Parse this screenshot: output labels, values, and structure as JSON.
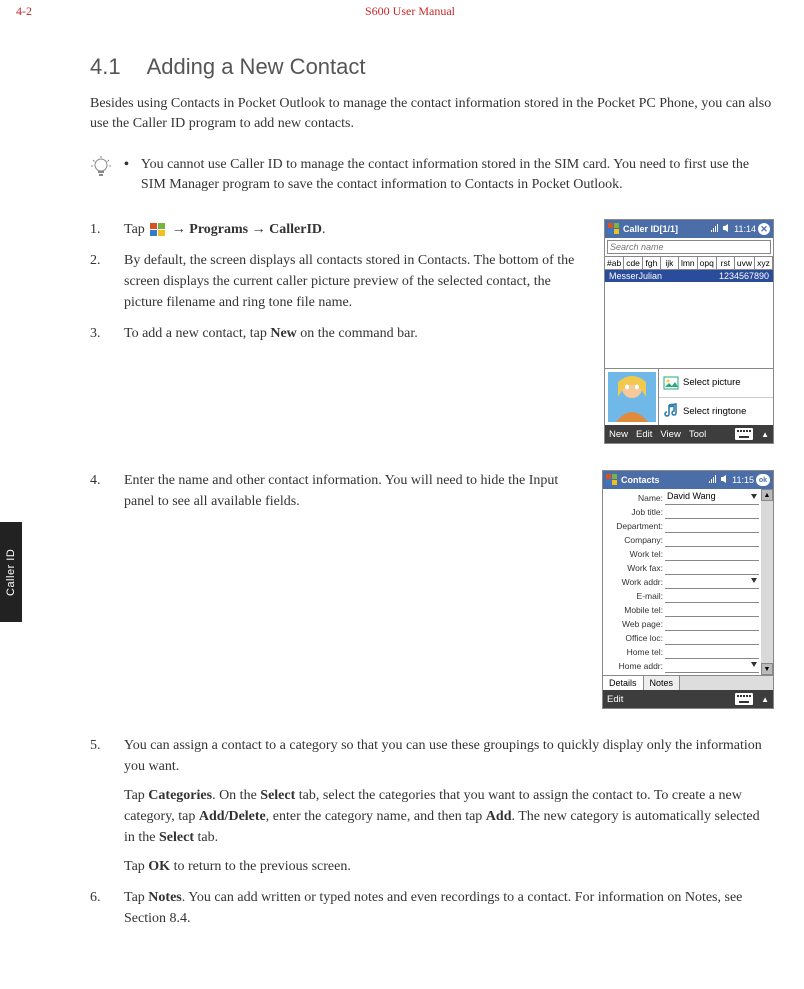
{
  "header": {
    "page": "4-2",
    "manual": "S600 User Manual"
  },
  "side_tab": "Caller ID",
  "section": {
    "number": "4.1",
    "title": "Adding a New Contact"
  },
  "intro": "Besides using Contacts in Pocket Outlook to manage the contact information stored in the Pocket PC Phone, you can also use the Caller ID program to add new contacts.",
  "note": {
    "bullet": "•",
    "text": "You cannot use Caller ID to manage the contact information stored in the SIM card. You need to first use the SIM Manager program to save the contact information to Contacts in Pocket Outlook."
  },
  "steps": {
    "s1_a": "Tap ",
    "s1_b": " → ",
    "s1_programs": "Programs",
    "s1_c": " → ",
    "s1_callerid": "CallerID",
    "s1_d": ".",
    "s2": "By default, the screen displays all contacts stored in Contacts. The bottom of the screen displays the current caller picture preview of the selected contact, the picture filename and ring tone file name.",
    "s3_a": "To add a new contact, tap ",
    "s3_b": "New",
    "s3_c": " on the command bar.",
    "s4": "Enter the name and other contact information. You will need to hide the Input panel to see all available fields.",
    "s5_p1": "You can assign a contact to a category so that you can use these groupings to quickly display only the information you want.",
    "s5_p2_a": "Tap ",
    "s5_p2_b": "Categories",
    "s5_p2_c": ". On the ",
    "s5_p2_d": "Select",
    "s5_p2_e": " tab, select the categories that you want to assign the contact to. To create a new category, tap ",
    "s5_p2_f": "Add/Delete",
    "s5_p2_g": ", enter the category name, and then tap ",
    "s5_p2_h": "Add",
    "s5_p2_i": ". The new category is automatically selected in the ",
    "s5_p2_j": "Select",
    "s5_p2_k": " tab.",
    "s5_p3_a": "Tap ",
    "s5_p3_b": "OK",
    "s5_p3_c": " to return to the previous screen.",
    "s6_a": "Tap ",
    "s6_b": "Notes",
    "s6_c": ". You can add written or typed notes and even recordings to a contact. For information on Notes, see Section 8.4."
  },
  "shot1": {
    "title": "Caller ID[1/1]",
    "time": "11:14",
    "search_ph": "Search name",
    "tabs": [
      "#ab",
      "cde",
      "fgh",
      "ijk",
      "lmn",
      "opq",
      "rst",
      "uvw",
      "xyz"
    ],
    "contact_name": "MesserJulian",
    "contact_num": "1234567890",
    "btn_pic": "Select picture",
    "btn_ring": "Select ringtone",
    "cmd": [
      "New",
      "Edit",
      "View",
      "Tool"
    ]
  },
  "shot2": {
    "title": "Contacts",
    "time": "11:15",
    "ok": "ok",
    "labels": [
      "Name:",
      "Job title:",
      "Department:",
      "Company:",
      "Work tel:",
      "Work fax:",
      "Work addr:",
      "E-mail:",
      "Mobile tel:",
      "Web page:",
      "Office loc:",
      "Home tel:",
      "Home addr:"
    ],
    "name_val": "David Wang",
    "tabs": [
      "Details",
      "Notes"
    ],
    "cmd": "Edit"
  }
}
